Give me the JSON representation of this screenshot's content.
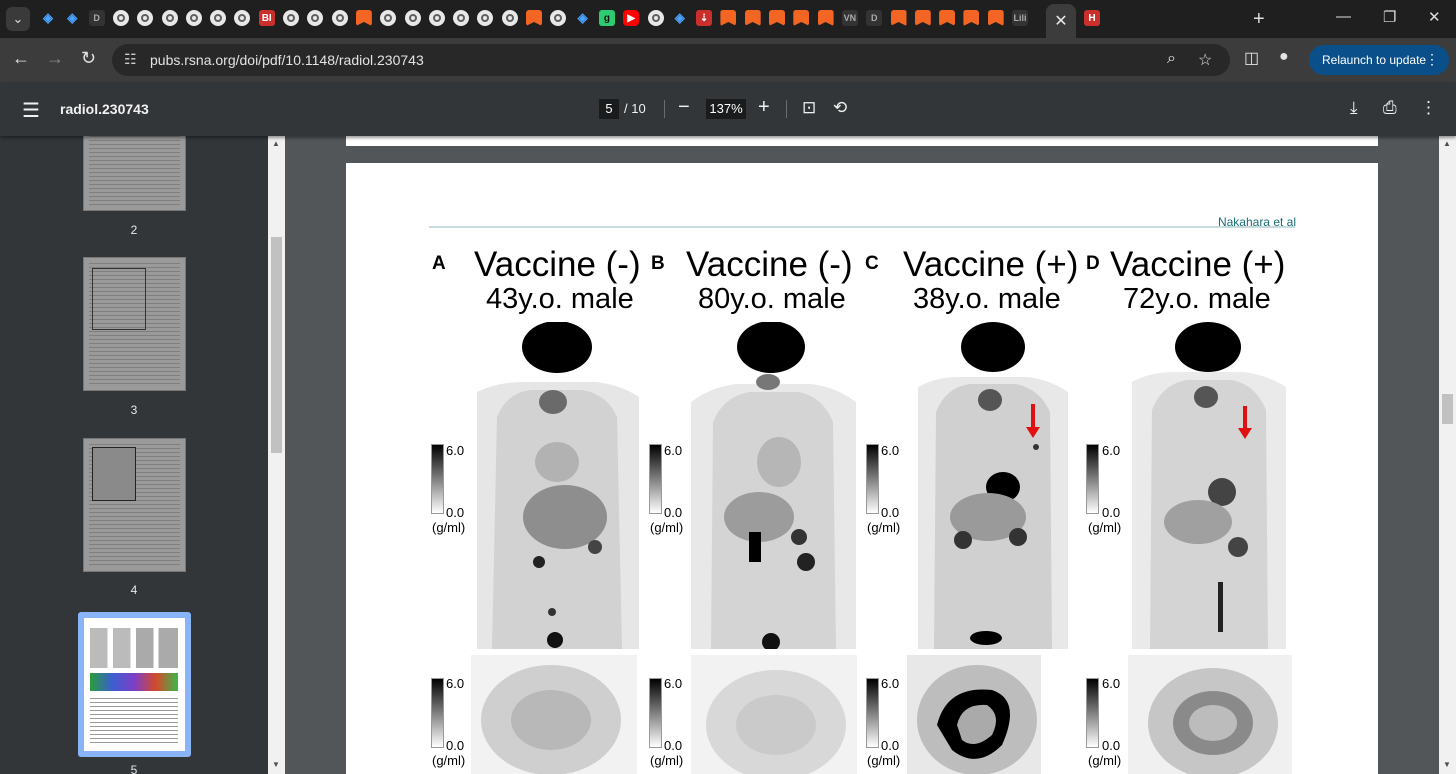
{
  "browser": {
    "active_tab_close": "✕",
    "new_tab": "+",
    "url": "pubs.rsna.org/doi/pdf/10.1148/radiol.230743",
    "relaunch_label": "Relaunch to update",
    "tab_icons": [
      "search",
      "shield",
      "shield",
      "dark-d",
      "globe",
      "globe",
      "globe",
      "globe",
      "globe",
      "globe",
      "red-bi",
      "globe",
      "globe",
      "globe",
      "orange",
      "globe",
      "globe",
      "globe",
      "globe",
      "globe",
      "globe",
      "orange",
      "globe",
      "shield",
      "green-g",
      "youtube",
      "globe",
      "shield",
      "red-arrow",
      "orange",
      "orange",
      "orange",
      "orange",
      "orange",
      "dark-vn",
      "dark-d",
      "orange",
      "orange",
      "orange",
      "orange",
      "orange",
      "dark-lili",
      "red-h"
    ],
    "bi_label": "BI",
    "g_label": "g",
    "h_label": "H",
    "vn_label": "VN",
    "li_label": "Lili"
  },
  "pdf_toolbar": {
    "title": "radiol.230743",
    "page_current": "5",
    "page_total": "/ 10",
    "zoom": "137%"
  },
  "sidebar": {
    "thumbnails": [
      {
        "label": "2"
      },
      {
        "label": "3"
      },
      {
        "label": "4"
      },
      {
        "label": "5"
      }
    ]
  },
  "document": {
    "author": "Nakahara et al",
    "panels": [
      {
        "letter": "A",
        "title": "Vaccine (-)",
        "subtitle": "43y.o. male"
      },
      {
        "letter": "B",
        "title": "Vaccine (-)",
        "subtitle": "80y.o. male"
      },
      {
        "letter": "C",
        "title": "Vaccine (+)",
        "subtitle": "38y.o. male"
      },
      {
        "letter": "D",
        "title": "Vaccine (+)",
        "subtitle": "72y.o. male"
      }
    ],
    "scale_max": "6.0",
    "scale_min": "0.0",
    "scale_unit": "(g/ml)"
  }
}
